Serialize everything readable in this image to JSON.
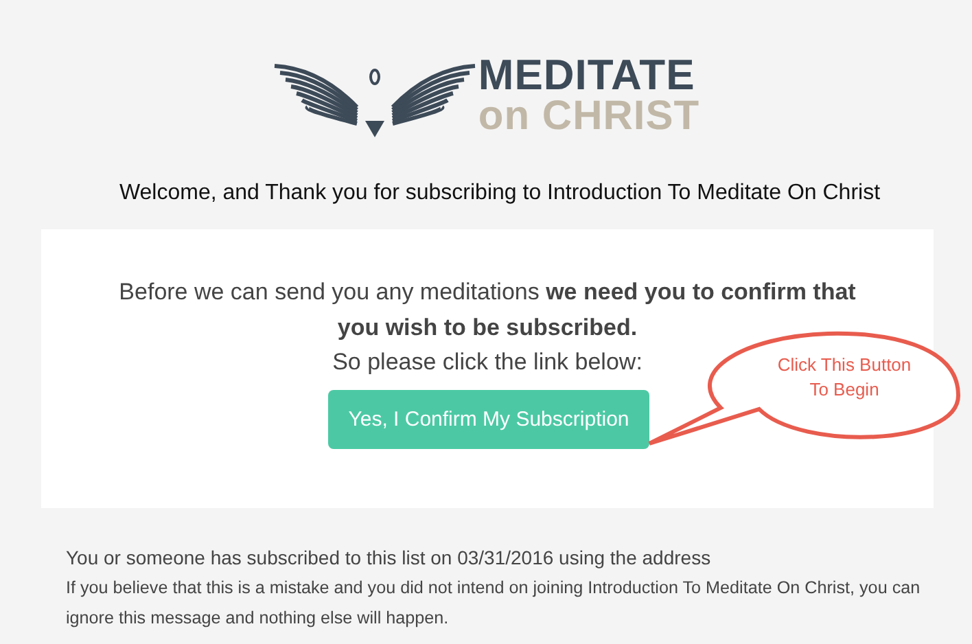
{
  "logo": {
    "line_1": "MEDITATE",
    "line_2": "on CHRIST"
  },
  "heading": "Welcome, and Thank you for subscribing to Introduction To Meditate On Christ",
  "card": {
    "message": "Before we can send you any meditations **we need you to confirm that you wish to be subscribed.**",
    "instruction": "So please click the link below:",
    "button": "Yes, I Confirm My Subscription"
  },
  "callout": {
    "line_1": "Click This Button",
    "line_2": "To Begin"
  },
  "footer": [
    "You or someone has subscribed to this list on 03/31/2016 using the address",
    "If you believe that this is a mistake and you did not intend on joining Introduction To Meditate On Christ, you can ignore this message and nothing else will happen."
  ]
}
